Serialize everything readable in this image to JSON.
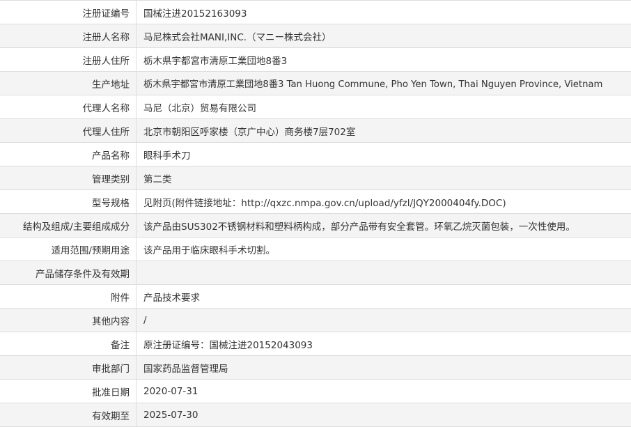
{
  "rows": [
    {
      "label": "注册证编号",
      "value": "国械注进20152163093"
    },
    {
      "label": "注册人名称",
      "value": "马尼株式会社MANI,INC.（マニー株式会社）"
    },
    {
      "label": "注册人住所",
      "value": "栃木県宇都宮市清原工業団地8番3"
    },
    {
      "label": "生产地址",
      "value": "栃木県宇都宮市清原工業団地8番3 Tan Huong Commune, Pho Yen Town, Thai Nguyen Province, Vietnam"
    },
    {
      "label": "代理人名称",
      "value": "马尼（北京）贸易有限公司"
    },
    {
      "label": "代理人住所",
      "value": "北京市朝阳区呼家楼（京广中心）商务楼7层702室"
    },
    {
      "label": "产品名称",
      "value": "眼科手术刀"
    },
    {
      "label": "管理类别",
      "value": "第二类"
    },
    {
      "label": "型号规格",
      "value": "见附页(附件链接地址：http://qxzc.nmpa.gov.cn/upload/yfzl/JQY2000404fy.DOC)"
    },
    {
      "label": "结构及组成/主要组成成分",
      "value": "该产品由SUS302不锈钢材料和塑料柄构成，部分产品带有安全套管。环氧乙烷灭菌包装，一次性使用。"
    },
    {
      "label": "适用范围/预期用途",
      "value": "该产品用于临床眼科手术切割。"
    },
    {
      "label": "产品储存条件及有效期",
      "value": ""
    },
    {
      "label": "附件",
      "value": "产品技术要求"
    },
    {
      "label": "其他内容",
      "value": "/"
    },
    {
      "label": "备注",
      "value": "原注册证编号：国械注进20152043093"
    },
    {
      "label": "审批部门",
      "value": "国家药品监督管理局"
    },
    {
      "label": "批准日期",
      "value": "2020-07-31"
    },
    {
      "label": "有效期至",
      "value": "2025-07-30"
    }
  ],
  "colors": {
    "text": "#333333",
    "border": "#dddddd",
    "stripe": "#f4f4f4"
  }
}
